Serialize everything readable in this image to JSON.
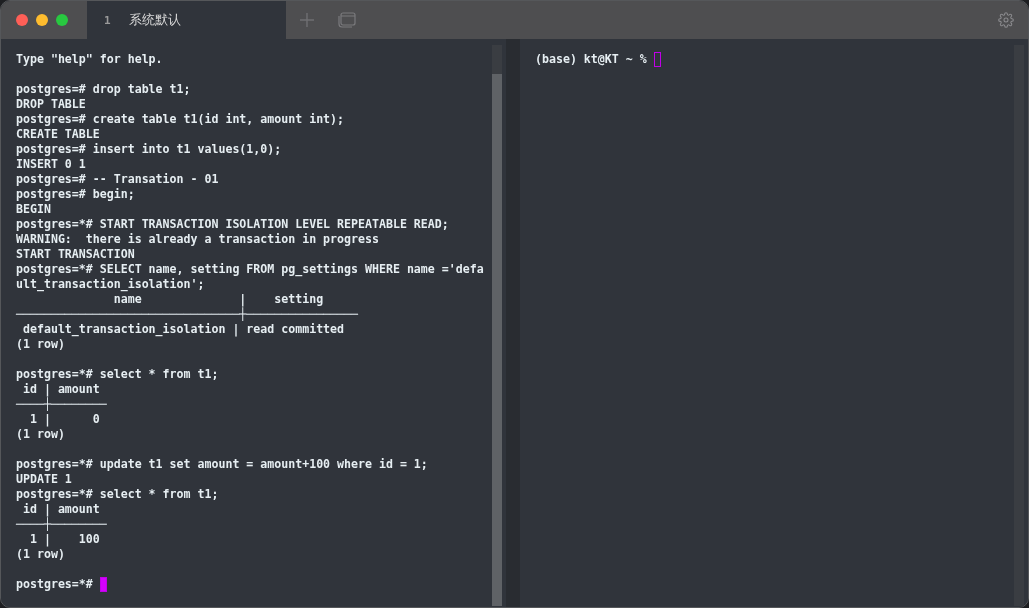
{
  "tabs": [
    {
      "number": "1",
      "title": "系统默认",
      "selected": true
    }
  ],
  "panes": [
    {
      "focused": true,
      "blocks": [
        [
          "Type \"help\" for help."
        ],
        [
          "postgres=# drop table t1;",
          "DROP TABLE",
          "postgres=# create table t1(id int, amount int);",
          "CREATE TABLE",
          "postgres=# insert into t1 values(1,0);",
          "INSERT 0 1",
          "postgres=# -- Transation - 01",
          "postgres=# begin;",
          "BEGIN",
          "postgres=*# START TRANSACTION ISOLATION LEVEL REPEATABLE READ;",
          "WARNING:  there is already a transaction in progress",
          "START TRANSACTION",
          "postgres=*# SELECT name, setting FROM pg_settings WHERE name ='defa",
          "ult_transaction_isolation';",
          "              name              |    setting",
          "────────────────────────────────┼────────────────",
          " default_transaction_isolation | read committed",
          "(1 row)"
        ],
        [
          "postgres=*# select * from t1;",
          " id | amount",
          "────┼────────",
          "  1 |      0",
          "(1 row)"
        ],
        [
          "postgres=*# update t1 set amount = amount+100 where id = 1;",
          "UPDATE 1",
          "postgres=*# select * from t1;",
          " id | amount",
          "────┼────────",
          "  1 |    100",
          "(1 row)"
        ]
      ],
      "prompt": "postgres=*# "
    },
    {
      "focused": false,
      "prompt": "(base) kt@KT ~ % "
    }
  ]
}
